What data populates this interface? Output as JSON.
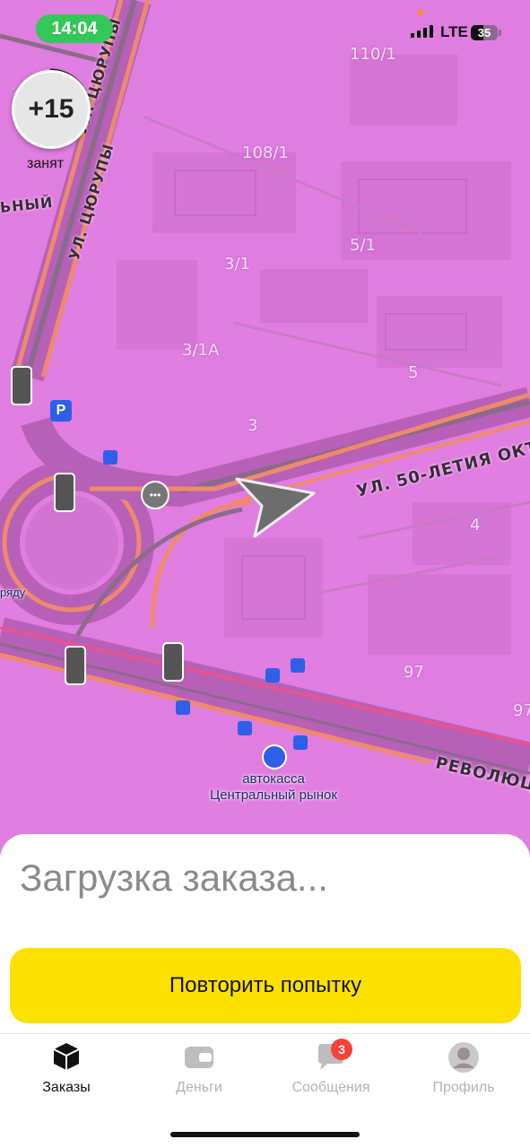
{
  "status_bar": {
    "time": "14:04",
    "network": "LTE",
    "battery": "35"
  },
  "driver": {
    "score": "+15",
    "status": "занят"
  },
  "map": {
    "house_numbers": [
      "110/1",
      "108/1",
      "5/1",
      "3/1",
      "3/1А",
      "5",
      "3",
      "4",
      "97",
      "97"
    ],
    "streets": [
      "ул. Цюрупы",
      "ул. Цюрупы",
      "ул. 50-летия Окт",
      "Революци"
    ],
    "partial_labels": [
      "ьный",
      "ряду"
    ],
    "poi": {
      "line1": "автокасса",
      "line2": "Центральный рынок"
    },
    "parking": "P"
  },
  "order": {
    "loading_text": "Загрузка заказа...",
    "retry_label": "Повторить попытку"
  },
  "tabs": [
    {
      "label": "Заказы",
      "icon": "box-icon",
      "active": true
    },
    {
      "label": "Деньги",
      "icon": "wallet-icon",
      "active": false
    },
    {
      "label": "Сообщения",
      "icon": "chat-icon",
      "active": false,
      "badge": "3"
    },
    {
      "label": "Профиль",
      "icon": "avatar-icon",
      "active": false
    }
  ],
  "colors": {
    "map_tint": "#e07de0",
    "accent": "#fce000",
    "badge": "#f5413b",
    "time_pill": "#34c759"
  }
}
